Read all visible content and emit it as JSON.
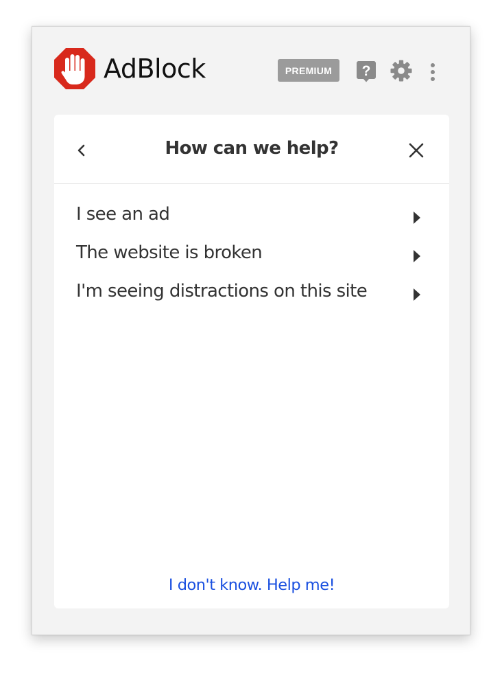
{
  "header": {
    "brand": "AdBlock",
    "premium_label": "PREMIUM",
    "icons": {
      "logo": "stop-hand-icon",
      "help": "help-icon",
      "settings": "gear-icon",
      "menu": "more-vertical-icon"
    }
  },
  "panel": {
    "title": "How can we help?",
    "options": [
      {
        "label": "I see an ad"
      },
      {
        "label": "The website is broken"
      },
      {
        "label": "I'm seeing distractions on this site"
      }
    ],
    "help_link": "I don't know. Help me!"
  },
  "colors": {
    "brand_red": "#d8291c",
    "link_blue": "#1a50e0",
    "badge_gray": "#9b9b9b",
    "icon_gray": "#8a8a8a",
    "text_dark": "#333333"
  }
}
